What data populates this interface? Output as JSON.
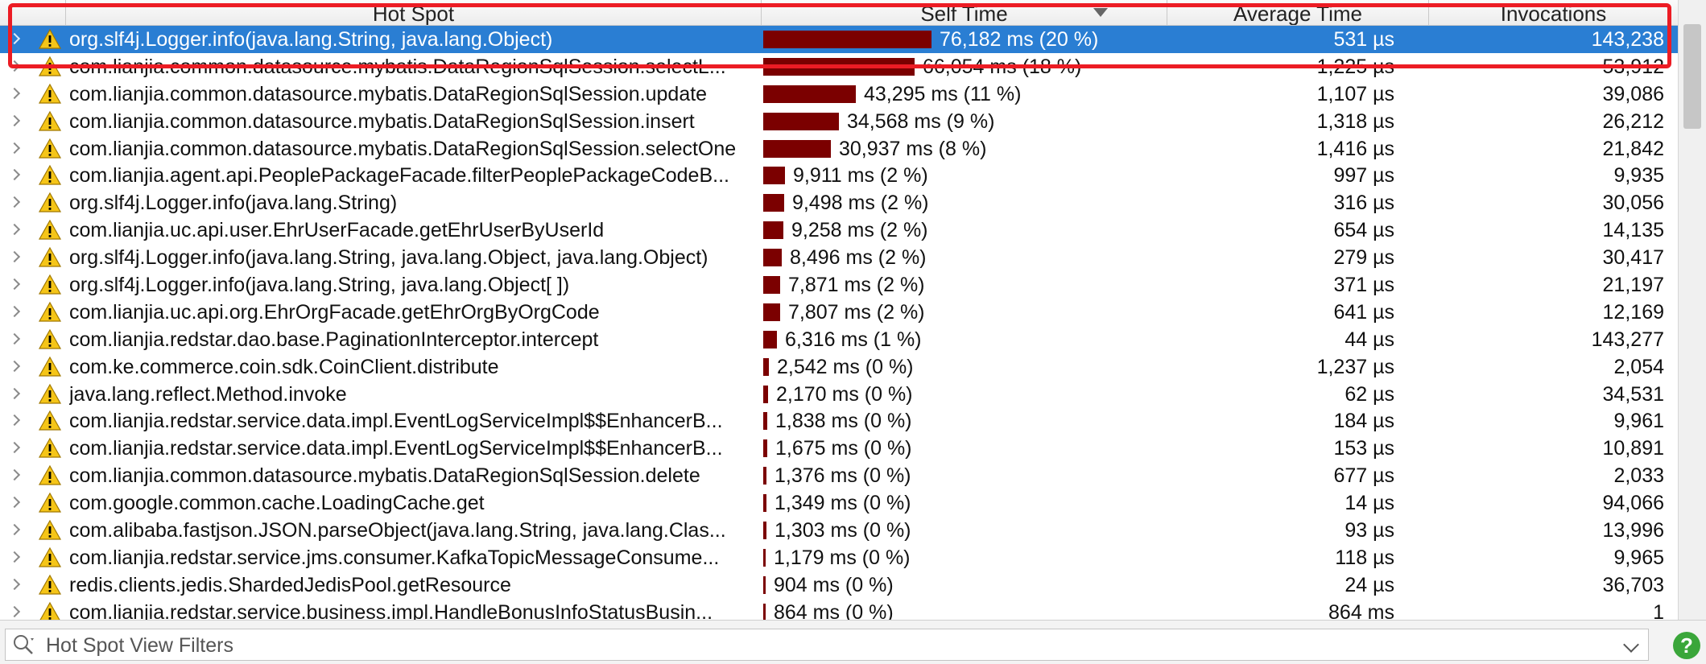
{
  "header": {
    "columns": [
      "Hot Spot",
      "Self Time",
      "Average Time",
      "Invocations"
    ]
  },
  "colors": {
    "selection": "#2a7ed3",
    "bar": "#7b0000",
    "highlight": "#ec1c24",
    "warning": "#f5c518"
  },
  "rows": [
    {
      "name": "org.slf4j.Logger.info(java.lang.String, java.lang.Object)",
      "self_time": "76,182 ms (20 %)",
      "share": 20,
      "avg": "531 µs",
      "inv": "143,238",
      "selected": true
    },
    {
      "name": "com.lianjia.common.datasource.mybatis.DataRegionSqlSession.selectL...",
      "self_time": "66,054 ms (18 %)",
      "share": 18,
      "avg": "1,225 µs",
      "inv": "53,912"
    },
    {
      "name": "com.lianjia.common.datasource.mybatis.DataRegionSqlSession.update",
      "self_time": "43,295 ms (11 %)",
      "share": 11,
      "avg": "1,107 µs",
      "inv": "39,086"
    },
    {
      "name": "com.lianjia.common.datasource.mybatis.DataRegionSqlSession.insert",
      "self_time": "34,568 ms (9 %)",
      "share": 9,
      "avg": "1,318 µs",
      "inv": "26,212"
    },
    {
      "name": "com.lianjia.common.datasource.mybatis.DataRegionSqlSession.selectOne",
      "self_time": "30,937 ms (8 %)",
      "share": 8,
      "avg": "1,416 µs",
      "inv": "21,842"
    },
    {
      "name": "com.lianjia.agent.api.PeoplePackageFacade.filterPeoplePackageCodeB...",
      "self_time": "9,911 ms (2 %)",
      "share": 2.6,
      "avg": "997 µs",
      "inv": "9,935"
    },
    {
      "name": "org.slf4j.Logger.info(java.lang.String)",
      "self_time": "9,498 ms (2 %)",
      "share": 2.5,
      "avg": "316 µs",
      "inv": "30,056"
    },
    {
      "name": "com.lianjia.uc.api.user.EhrUserFacade.getEhrUserByUserId",
      "self_time": "9,258 ms (2 %)",
      "share": 2.4,
      "avg": "654 µs",
      "inv": "14,135"
    },
    {
      "name": "org.slf4j.Logger.info(java.lang.String, java.lang.Object, java.lang.Object)",
      "self_time": "8,496 ms (2 %)",
      "share": 2.2,
      "avg": "279 µs",
      "inv": "30,417"
    },
    {
      "name": "org.slf4j.Logger.info(java.lang.String, java.lang.Object[ ])",
      "self_time": "7,871 ms (2 %)",
      "share": 2.05,
      "avg": "371 µs",
      "inv": "21,197"
    },
    {
      "name": "com.lianjia.uc.api.org.EhrOrgFacade.getEhrOrgByOrgCode",
      "self_time": "7,807 ms (2 %)",
      "share": 2.0,
      "avg": "641 µs",
      "inv": "12,169"
    },
    {
      "name": "com.lianjia.redstar.dao.base.PaginationInterceptor.intercept",
      "self_time": "6,316 ms (1 %)",
      "share": 1.6,
      "avg": "44 µs",
      "inv": "143,277"
    },
    {
      "name": "com.ke.commerce.coin.sdk.CoinClient.distribute",
      "self_time": "2,542 ms (0 %)",
      "share": 0.66,
      "avg": "1,237 µs",
      "inv": "2,054"
    },
    {
      "name": "java.lang.reflect.Method.invoke",
      "self_time": "2,170 ms (0 %)",
      "share": 0.56,
      "avg": "62 µs",
      "inv": "34,531"
    },
    {
      "name": "com.lianjia.redstar.service.data.impl.EventLogServiceImpl$$EnhancerB...",
      "self_time": "1,838 ms (0 %)",
      "share": 0.48,
      "avg": "184 µs",
      "inv": "9,961"
    },
    {
      "name": "com.lianjia.redstar.service.data.impl.EventLogServiceImpl$$EnhancerB...",
      "self_time": "1,675 ms (0 %)",
      "share": 0.44,
      "avg": "153 µs",
      "inv": "10,891"
    },
    {
      "name": "com.lianjia.common.datasource.mybatis.DataRegionSqlSession.delete",
      "self_time": "1,376 ms (0 %)",
      "share": 0.36,
      "avg": "677 µs",
      "inv": "2,033"
    },
    {
      "name": "com.google.common.cache.LoadingCache.get",
      "self_time": "1,349 ms (0 %)",
      "share": 0.35,
      "avg": "14 µs",
      "inv": "94,066"
    },
    {
      "name": "com.alibaba.fastjson.JSON.parseObject(java.lang.String, java.lang.Clas...",
      "self_time": "1,303 ms (0 %)",
      "share": 0.34,
      "avg": "93 µs",
      "inv": "13,996"
    },
    {
      "name": "com.lianjia.redstar.service.jms.consumer.KafkaTopicMessageConsume...",
      "self_time": "1,179 ms (0 %)",
      "share": 0.31,
      "avg": "118 µs",
      "inv": "9,965"
    },
    {
      "name": "redis.clients.jedis.ShardedJedisPool.getResource",
      "self_time": "904 ms (0 %)",
      "share": 0.24,
      "avg": "24 µs",
      "inv": "36,703"
    },
    {
      "name": "com.lianjia.redstar.service.business.impl.HandleBonusInfoStatusBusin...",
      "self_time": "864 ms (0 %)",
      "share": 0.22,
      "avg": "864 ms",
      "inv": "1"
    }
  ],
  "filter": {
    "placeholder": "Hot Spot View Filters"
  },
  "help": {
    "label": "?"
  }
}
